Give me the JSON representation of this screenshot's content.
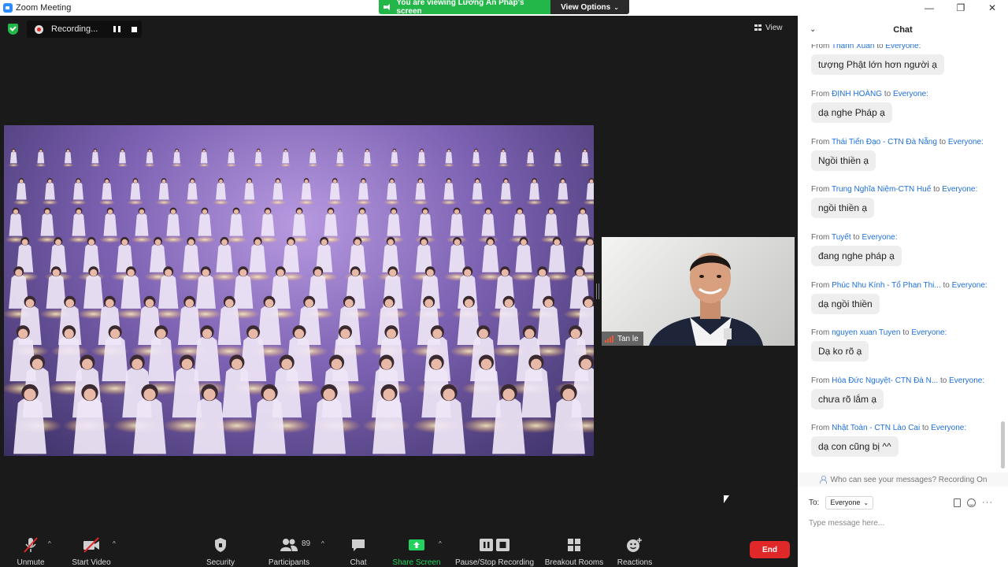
{
  "window": {
    "title": "Zoom Meeting",
    "min_glyph": "—",
    "max_glyph": "❐",
    "close_glyph": "✕"
  },
  "share_banner": {
    "text": "You are viewing Lương Ấn Pháp's screen",
    "view_options": "View Options",
    "color": "#23b74a"
  },
  "recording": {
    "label": "Recording..."
  },
  "view": {
    "label": "View"
  },
  "video": {
    "participant_name": "Tan le"
  },
  "toolbar": {
    "unmute": "Unmute",
    "start_video": "Start Video",
    "security": "Security",
    "participants": "Participants",
    "participants_count": "89",
    "chat": "Chat",
    "share_screen": "Share Screen",
    "pause_stop_recording": "Pause/Stop Recording",
    "breakout_rooms": "Breakout Rooms",
    "reactions": "Reactions",
    "end": "End",
    "end_color": "#e02828"
  },
  "chat": {
    "title": "Chat",
    "from_word": "From",
    "to_word": "to",
    "messages": [
      {
        "sender": "Thanh Xuân",
        "recipient": "Everyone:",
        "text": "tượng Phật lớn hơn người ạ"
      },
      {
        "sender": "ĐỊNH HOÀNG",
        "recipient": "Everyone:",
        "text": "dạ nghe Pháp ạ"
      },
      {
        "sender": "Thái Tiến Đạo - CTN Đà Nẵng",
        "recipient": "Everyone:",
        "text": "Ngồi thiền ạ"
      },
      {
        "sender": "Trung Nghĩa Niệm-CTN Huế",
        "recipient": "Everyone:",
        "text": "ngồi thiền ạ"
      },
      {
        "sender": "Tuyết",
        "recipient": "Everyone:",
        "text": "đang nghe pháp ạ"
      },
      {
        "sender": "Phúc Nhu Kính - Tổ Phan Thi...",
        "recipient": "Everyone:",
        "text": "dạ ngồi thiền"
      },
      {
        "sender": "nguyen xuan Tuyen",
        "recipient": "Everyone:",
        "text": "Dạ ko rõ ạ"
      },
      {
        "sender": "Hòa Đức Nguyệt- CTN Đà N...",
        "recipient": "Everyone:",
        "text": "chưa rõ lắm ạ"
      },
      {
        "sender": "Nhật Toàn - CTN Lào Cai",
        "recipient": "Everyone:",
        "text": "dạ con cũng bị ^^"
      }
    ],
    "privacy_notice": "Who can see your messages? Recording On",
    "to_label": "To:",
    "to_value": "Everyone",
    "input_placeholder": "Type message here..."
  }
}
